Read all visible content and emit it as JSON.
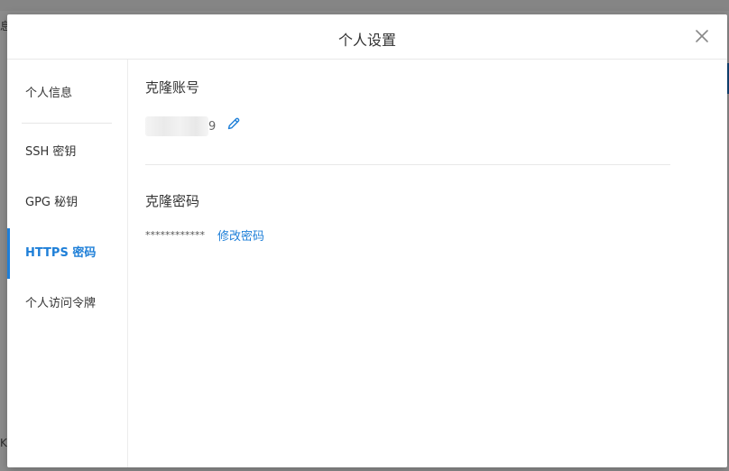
{
  "modal": {
    "title": "个人设置"
  },
  "sidebar": {
    "items": [
      {
        "label": "个人信息",
        "active": false
      },
      {
        "label": "SSH 密钥",
        "active": false
      },
      {
        "label": "GPG 秘钥",
        "active": false
      },
      {
        "label": "HTTPS 密码",
        "active": true
      },
      {
        "label": "个人访问令牌",
        "active": false
      }
    ]
  },
  "content": {
    "clone_account": {
      "title": "克隆账号",
      "value_visible_tail": "9"
    },
    "clone_password": {
      "title": "克隆密码",
      "masked_value": "************",
      "change_link": "修改密码"
    }
  },
  "background": {
    "left_fragment_top": "息",
    "left_fragment_bottom": "K"
  },
  "colors": {
    "accent": "#1e7fd8",
    "text": "#333333",
    "divider": "#e8e8e8"
  },
  "icons": {
    "close": "close-icon",
    "edit": "pencil-icon"
  }
}
